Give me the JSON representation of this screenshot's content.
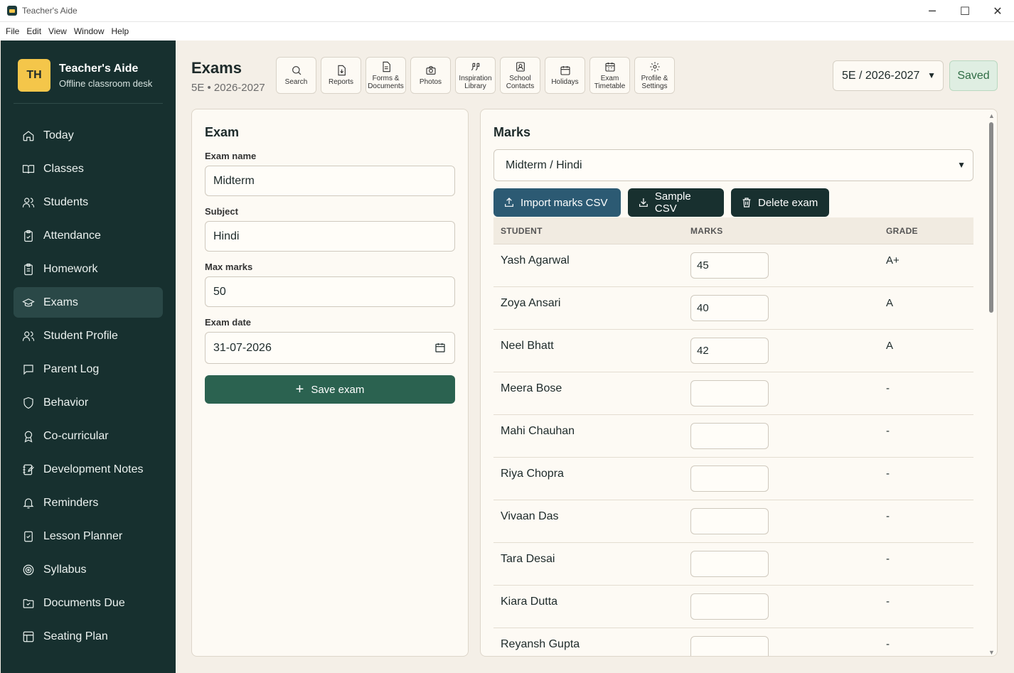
{
  "window": {
    "title": "Teacher's Aide",
    "minimize": "─",
    "maximize": "☐",
    "close": "✕"
  },
  "menu": [
    "File",
    "Edit",
    "View",
    "Window",
    "Help"
  ],
  "brand": {
    "initials": "TH",
    "name": "Teacher's Aide",
    "subtitle": "Offline classroom desk"
  },
  "sidebar": {
    "items": [
      {
        "label": "Today",
        "icon": "home-icon"
      },
      {
        "label": "Classes",
        "icon": "book-open-icon"
      },
      {
        "label": "Students",
        "icon": "users-icon"
      },
      {
        "label": "Attendance",
        "icon": "clipboard-check-icon"
      },
      {
        "label": "Homework",
        "icon": "clipboard-list-icon"
      },
      {
        "label": "Exams",
        "icon": "graduation-cap-icon",
        "active": true
      },
      {
        "label": "Student Profile",
        "icon": "user-profile-icon"
      },
      {
        "label": "Parent Log",
        "icon": "message-square-icon"
      },
      {
        "label": "Behavior",
        "icon": "shield-icon"
      },
      {
        "label": "Co-curricular",
        "icon": "award-icon"
      },
      {
        "label": "Development Notes",
        "icon": "notebook-pen-icon"
      },
      {
        "label": "Reminders",
        "icon": "bell-icon"
      },
      {
        "label": "Lesson Planner",
        "icon": "book-check-icon"
      },
      {
        "label": "Syllabus",
        "icon": "target-icon"
      },
      {
        "label": "Documents Due",
        "icon": "folder-check-icon"
      },
      {
        "label": "Seating Plan",
        "icon": "layout-grid-icon"
      }
    ]
  },
  "header": {
    "title": "Exams",
    "subtitle": "5E • 2026-2027"
  },
  "toolbar": [
    {
      "label": "Search",
      "icon": "search-icon"
    },
    {
      "label": "Reports",
      "icon": "file-download-icon"
    },
    {
      "label": "Forms & Documents",
      "icon": "file-text-icon"
    },
    {
      "label": "Photos",
      "icon": "camera-icon"
    },
    {
      "label": "Inspiration Library",
      "icon": "quote-icon"
    },
    {
      "label": "School Contacts",
      "icon": "contact-icon"
    },
    {
      "label": "Holidays",
      "icon": "calendar-icon"
    },
    {
      "label": "Exam Timetable",
      "icon": "calendar-days-icon"
    },
    {
      "label": "Profile & Settings",
      "icon": "gear-icon"
    }
  ],
  "class_select": {
    "value": "5E / 2026-2027"
  },
  "status": {
    "saved": "Saved"
  },
  "exam_form": {
    "title": "Exam",
    "name_label": "Exam name",
    "name_value": "Midterm",
    "subject_label": "Subject",
    "subject_value": "Hindi",
    "max_label": "Max marks",
    "max_value": "50",
    "date_label": "Exam date",
    "date_value": "31-07-2026",
    "save_label": "Save exam"
  },
  "marks": {
    "title": "Marks",
    "exam_select": "Midterm / Hindi",
    "import_label": "Import marks CSV",
    "sample_label": "Sample CSV",
    "delete_label": "Delete exam",
    "columns": {
      "student": "STUDENT",
      "marks": "MARKS",
      "grade": "GRADE"
    },
    "rows": [
      {
        "student": "Yash Agarwal",
        "marks": "45",
        "grade": "A+"
      },
      {
        "student": "Zoya Ansari",
        "marks": "40",
        "grade": "A"
      },
      {
        "student": "Neel Bhatt",
        "marks": "42",
        "grade": "A"
      },
      {
        "student": "Meera Bose",
        "marks": "",
        "grade": "-"
      },
      {
        "student": "Mahi Chauhan",
        "marks": "",
        "grade": "-"
      },
      {
        "student": "Riya Chopra",
        "marks": "",
        "grade": "-"
      },
      {
        "student": "Vivaan Das",
        "marks": "",
        "grade": "-"
      },
      {
        "student": "Tara Desai",
        "marks": "",
        "grade": "-"
      },
      {
        "student": "Kiara Dutta",
        "marks": "",
        "grade": "-"
      },
      {
        "student": "Reyansh Gupta",
        "marks": "",
        "grade": "-"
      }
    ]
  }
}
